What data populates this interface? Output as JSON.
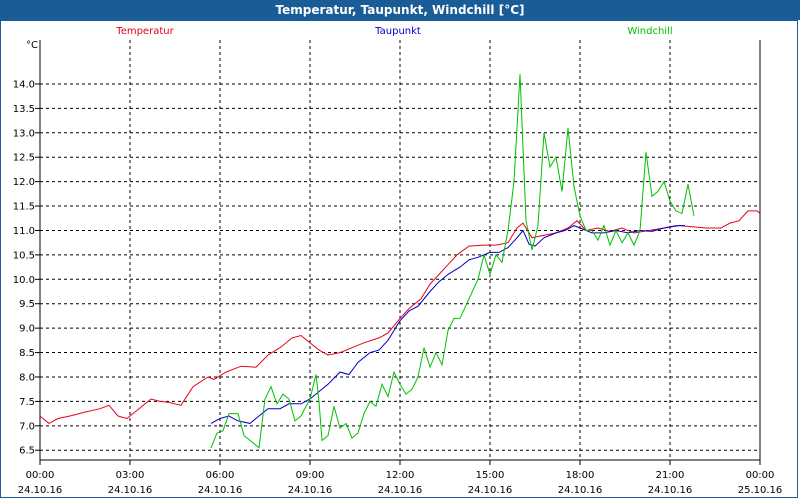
{
  "window": {
    "title": "Temperatur, Taupunkt, Windchill [°C]"
  },
  "colors": {
    "titlebar": "#1a5d96",
    "temperatur": "#e8001a",
    "taupunkt": "#0000c8",
    "windchill": "#00c000",
    "grid": "#000000"
  },
  "chart_data": {
    "type": "line",
    "title": "Temperatur, Taupunkt, Windchill [°C]",
    "ylabel": "°C",
    "ylim": [
      6.3,
      14.9
    ],
    "xlim": [
      0,
      24
    ],
    "y_ticks": [
      "6.5",
      "7.0",
      "7.5",
      "8.0",
      "8.5",
      "9.0",
      "9.5",
      "10.0",
      "10.5",
      "11.0",
      "11.5",
      "12.0",
      "12.5",
      "13.0",
      "13.5",
      "14.0"
    ],
    "x_ticks": [
      {
        "time": "00:00",
        "date": "24.10.16",
        "h": 0
      },
      {
        "time": "03:00",
        "date": "24.10.16",
        "h": 3
      },
      {
        "time": "06:00",
        "date": "24.10.16",
        "h": 6
      },
      {
        "time": "09:00",
        "date": "24.10.16",
        "h": 9
      },
      {
        "time": "12:00",
        "date": "24.10.16",
        "h": 12
      },
      {
        "time": "15:00",
        "date": "24.10.16",
        "h": 15
      },
      {
        "time": "18:00",
        "date": "24.10.16",
        "h": 18
      },
      {
        "time": "21:00",
        "date": "24.10.16",
        "h": 21
      },
      {
        "time": "00:00",
        "date": "25.10.16",
        "h": 24
      }
    ],
    "grid": true,
    "legend_position": "top",
    "series": [
      {
        "name": "Temperatur",
        "color": "#e8001a",
        "points": [
          [
            0,
            7.2
          ],
          [
            0.3,
            7.05
          ],
          [
            0.6,
            7.15
          ],
          [
            1,
            7.2
          ],
          [
            1.5,
            7.28
          ],
          [
            2,
            7.35
          ],
          [
            2.3,
            7.42
          ],
          [
            2.6,
            7.2
          ],
          [
            2.9,
            7.15
          ],
          [
            3.3,
            7.35
          ],
          [
            3.7,
            7.55
          ],
          [
            4,
            7.5
          ],
          [
            4.3,
            7.48
          ],
          [
            4.7,
            7.42
          ],
          [
            5.1,
            7.8
          ],
          [
            5.6,
            8.0
          ],
          [
            5.8,
            7.95
          ],
          [
            6.2,
            8.1
          ],
          [
            6.7,
            8.22
          ],
          [
            7.2,
            8.2
          ],
          [
            7.6,
            8.45
          ],
          [
            8,
            8.6
          ],
          [
            8.4,
            8.8
          ],
          [
            8.7,
            8.85
          ],
          [
            9,
            8.7
          ],
          [
            9.3,
            8.55
          ],
          [
            9.6,
            8.45
          ],
          [
            10,
            8.5
          ],
          [
            10.4,
            8.6
          ],
          [
            10.8,
            8.7
          ],
          [
            11.3,
            8.8
          ],
          [
            11.6,
            8.9
          ],
          [
            12,
            9.2
          ],
          [
            12.3,
            9.4
          ],
          [
            12.7,
            9.6
          ],
          [
            13,
            9.9
          ],
          [
            13.3,
            10.1
          ],
          [
            13.6,
            10.3
          ],
          [
            13.9,
            10.5
          ],
          [
            14.3,
            10.68
          ],
          [
            14.8,
            10.7
          ],
          [
            15.2,
            10.7
          ],
          [
            15.6,
            10.75
          ],
          [
            15.9,
            11.05
          ],
          [
            16.1,
            11.15
          ],
          [
            16.4,
            10.85
          ],
          [
            16.8,
            10.9
          ],
          [
            17.2,
            10.95
          ],
          [
            17.6,
            11.05
          ],
          [
            17.9,
            11.2
          ],
          [
            18.2,
            11.0
          ],
          [
            18.6,
            11.05
          ],
          [
            19,
            10.98
          ],
          [
            19.4,
            11.05
          ],
          [
            19.8,
            10.95
          ],
          [
            20.3,
            11.0
          ],
          [
            20.8,
            11.05
          ],
          [
            21.3,
            11.1
          ],
          [
            21.7,
            11.08
          ],
          [
            22.2,
            11.05
          ],
          [
            22.7,
            11.05
          ],
          [
            23,
            11.15
          ],
          [
            23.3,
            11.2
          ],
          [
            23.6,
            11.4
          ],
          [
            23.9,
            11.4
          ],
          [
            24,
            11.35
          ]
        ]
      },
      {
        "name": "Taupunkt",
        "color": "#0000c8",
        "points": [
          [
            5.7,
            7.05
          ],
          [
            6,
            7.15
          ],
          [
            6.3,
            7.2
          ],
          [
            6.6,
            7.1
          ],
          [
            7,
            7.05
          ],
          [
            7.3,
            7.2
          ],
          [
            7.6,
            7.35
          ],
          [
            8,
            7.35
          ],
          [
            8.3,
            7.45
          ],
          [
            8.7,
            7.45
          ],
          [
            9,
            7.55
          ],
          [
            9.3,
            7.7
          ],
          [
            9.6,
            7.85
          ],
          [
            10,
            8.1
          ],
          [
            10.3,
            8.05
          ],
          [
            10.6,
            8.3
          ],
          [
            11,
            8.5
          ],
          [
            11.3,
            8.55
          ],
          [
            11.6,
            8.75
          ],
          [
            12,
            9.15
          ],
          [
            12.3,
            9.35
          ],
          [
            12.6,
            9.45
          ],
          [
            13,
            9.75
          ],
          [
            13.3,
            9.95
          ],
          [
            13.6,
            10.1
          ],
          [
            14,
            10.25
          ],
          [
            14.3,
            10.4
          ],
          [
            14.6,
            10.45
          ],
          [
            15,
            10.55
          ],
          [
            15.3,
            10.55
          ],
          [
            15.6,
            10.65
          ],
          [
            15.9,
            10.85
          ],
          [
            16.1,
            11.0
          ],
          [
            16.3,
            10.72
          ],
          [
            16.5,
            10.68
          ],
          [
            16.8,
            10.85
          ],
          [
            17.2,
            10.95
          ],
          [
            17.5,
            11.0
          ],
          [
            17.8,
            11.1
          ],
          [
            18,
            11.05
          ],
          [
            18.4,
            10.95
          ],
          [
            18.8,
            10.95
          ],
          [
            19.2,
            11.0
          ],
          [
            19.6,
            10.95
          ],
          [
            20,
            11.0
          ],
          [
            20.4,
            10.98
          ],
          [
            20.8,
            11.05
          ],
          [
            21.2,
            11.1
          ],
          [
            21.5,
            11.1
          ]
        ]
      },
      {
        "name": "Windchill",
        "color": "#00c000",
        "points": [
          [
            5.7,
            6.55
          ],
          [
            5.9,
            6.85
          ],
          [
            6.1,
            6.9
          ],
          [
            6.3,
            7.25
          ],
          [
            6.6,
            7.25
          ],
          [
            6.8,
            6.8
          ],
          [
            7.1,
            6.65
          ],
          [
            7.3,
            6.55
          ],
          [
            7.5,
            7.55
          ],
          [
            7.7,
            7.8
          ],
          [
            7.9,
            7.45
          ],
          [
            8.1,
            7.65
          ],
          [
            8.3,
            7.55
          ],
          [
            8.5,
            7.1
          ],
          [
            8.7,
            7.2
          ],
          [
            9,
            7.55
          ],
          [
            9.2,
            8.05
          ],
          [
            9.3,
            7.5
          ],
          [
            9.4,
            6.7
          ],
          [
            9.6,
            6.8
          ],
          [
            9.8,
            7.4
          ],
          [
            10,
            6.95
          ],
          [
            10.2,
            7.05
          ],
          [
            10.4,
            6.75
          ],
          [
            10.6,
            6.85
          ],
          [
            10.8,
            7.25
          ],
          [
            11,
            7.5
          ],
          [
            11.2,
            7.4
          ],
          [
            11.4,
            7.85
          ],
          [
            11.6,
            7.6
          ],
          [
            11.8,
            8.1
          ],
          [
            12,
            7.85
          ],
          [
            12.2,
            7.65
          ],
          [
            12.4,
            7.75
          ],
          [
            12.6,
            8.0
          ],
          [
            12.8,
            8.6
          ],
          [
            13,
            8.2
          ],
          [
            13.2,
            8.5
          ],
          [
            13.4,
            8.25
          ],
          [
            13.6,
            8.95
          ],
          [
            13.8,
            9.2
          ],
          [
            14,
            9.2
          ],
          [
            14.3,
            9.6
          ],
          [
            14.6,
            10.0
          ],
          [
            14.8,
            10.5
          ],
          [
            15,
            10.1
          ],
          [
            15.2,
            10.5
          ],
          [
            15.4,
            10.35
          ],
          [
            15.6,
            11.0
          ],
          [
            15.8,
            12.0
          ],
          [
            16,
            14.2
          ],
          [
            16.2,
            11.2
          ],
          [
            16.4,
            10.6
          ],
          [
            16.6,
            11.1
          ],
          [
            16.8,
            13.0
          ],
          [
            17,
            12.3
          ],
          [
            17.2,
            12.5
          ],
          [
            17.4,
            11.8
          ],
          [
            17.6,
            13.1
          ],
          [
            17.8,
            11.9
          ],
          [
            18,
            11.3
          ],
          [
            18.2,
            11.0
          ],
          [
            18.4,
            11.0
          ],
          [
            18.6,
            10.8
          ],
          [
            18.8,
            11.1
          ],
          [
            19,
            10.7
          ],
          [
            19.2,
            11.0
          ],
          [
            19.4,
            10.75
          ],
          [
            19.6,
            10.95
          ],
          [
            19.8,
            10.7
          ],
          [
            20,
            11.0
          ],
          [
            20.2,
            12.6
          ],
          [
            20.4,
            11.7
          ],
          [
            20.6,
            11.8
          ],
          [
            20.8,
            12.0
          ],
          [
            21,
            11.6
          ],
          [
            21.2,
            11.4
          ],
          [
            21.4,
            11.35
          ],
          [
            21.6,
            11.95
          ],
          [
            21.8,
            11.3
          ]
        ]
      }
    ]
  }
}
